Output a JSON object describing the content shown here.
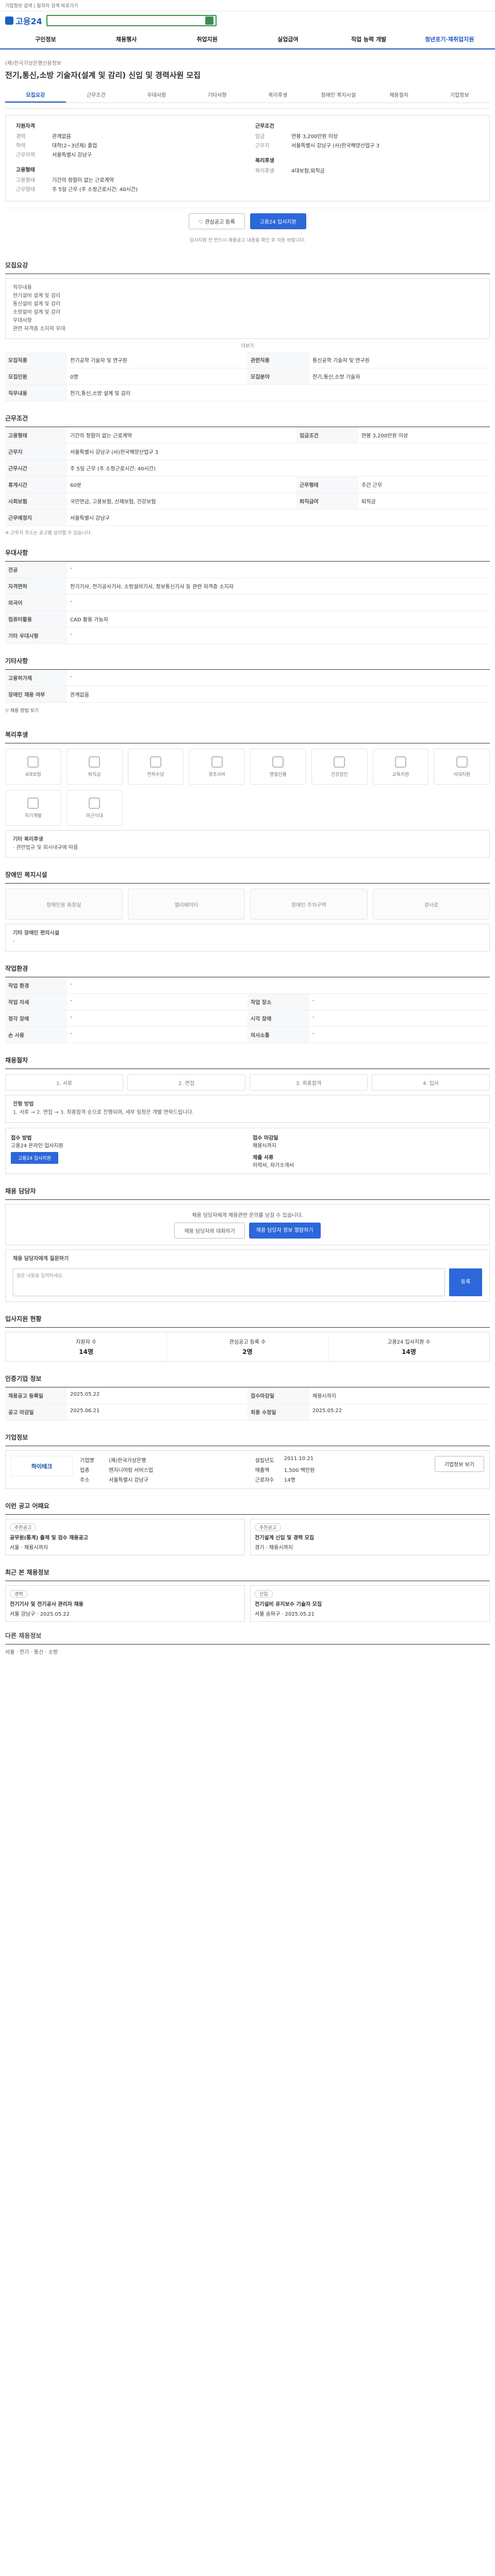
{
  "topbar": {
    "text": "기업정보 검색 | 일자리 검색 바로가기"
  },
  "header": {
    "logo": "고용24",
    "search_placeholder": ""
  },
  "nav": {
    "items": [
      "구인정보",
      "채용행사",
      "취업지원",
      "실업급여",
      "직업 능력 개발",
      "청년포기·재취업지원"
    ]
  },
  "hero": {
    "sub": "(재)한국가상은행신용정보",
    "title": "전기,통신,소방 기술자(설계 및 감리) 신입 및 경력사원 모집"
  },
  "tabs": [
    {
      "label": "모집요강",
      "on": true
    },
    {
      "label": "근무조건",
      "on": false
    },
    {
      "label": "우대사항",
      "on": false
    },
    {
      "label": "기타사항",
      "on": false
    },
    {
      "label": "복리후생",
      "on": false
    },
    {
      "label": "장애인 복지시설",
      "on": false
    },
    {
      "label": "채용절차",
      "on": false
    },
    {
      "label": "기업정보",
      "on": false
    }
  ],
  "summary": {
    "left_title": "지원자격",
    "left": [
      {
        "k": "경력",
        "v": "관계없음"
      },
      {
        "k": "학력",
        "v": "대학(2~3년제) 졸업"
      },
      {
        "k": "근무지역",
        "v": "서울특별시 강남구"
      }
    ],
    "left_title2": "고용형태",
    "left2": [
      {
        "k": "고용형태",
        "v": "기간의 정함이 없는 근로계약"
      },
      {
        "k": "근무형태",
        "v": "주 5일 근무 (주 소정근로시간: 40시간)"
      }
    ],
    "right_title": "근무조건",
    "right": [
      {
        "k": "임금",
        "v": "연봉 3,200만원 이상"
      },
      {
        "k": "근무지",
        "v": "서울특별시 강남구 (사)한국해양산업구 3"
      }
    ],
    "right_title2": "복리후생",
    "right2": [
      {
        "k": "복리후생",
        "v": "4대보험,퇴직금"
      }
    ]
  },
  "actions": {
    "save": "관심공고 등록",
    "apply": "고용24 입사지원"
  },
  "note": "입사지원 전 반드시 채용공고 내용을 확인 후 지원 바랍니다.",
  "recruit": {
    "title": "모집요강",
    "content_lines": [
      "직무내용",
      "전기설비 설계 및 감리",
      "통신설비 설계 및 감리",
      "소방설비 설계 및 감리",
      "우대사항",
      "관련 자격증 소지자 우대"
    ],
    "more": "더보기"
  },
  "recruit_table": [
    {
      "k": "모집직종",
      "v": "전기공학 기술자 및 연구원",
      "k2": "관련직종",
      "v2": "통신공학 기술자 및 연구원"
    },
    {
      "k": "모집인원",
      "v": "0명",
      "k2": "모집분야",
      "v2": "전기,통신,소방 기술자"
    },
    {
      "k": "직무내용",
      "v": "전기,통신,소방 설계 및 감리",
      "k2": "",
      "v2": ""
    }
  ],
  "conditions": {
    "title": "근무조건",
    "rows": [
      {
        "k": "고용형태",
        "v": "기간의 정함이 없는 근로계약",
        "k2": "임금조건",
        "v2": "연봉 3,200만원 이상"
      },
      {
        "k": "근무지",
        "v": "서울특별시 강남구 (사)한국해양산업구 3",
        "k2": "",
        "v2": ""
      },
      {
        "k": "근무시간",
        "v": "주 5일 근무 (주 소정근로시간: 40시간)",
        "k2": "",
        "v2": ""
      },
      {
        "k": "휴게시간",
        "v": "60분",
        "k2": "근무형태",
        "v2": "주간 근무"
      },
      {
        "k": "사회보험",
        "v": "국민연금, 고용보험, 산재보험, 건강보험",
        "k2": "퇴직급여",
        "v2": "퇴직금"
      },
      {
        "k": "근무예정지",
        "v": "서울특별시 강남구",
        "k2": "",
        "v2": ""
      }
    ],
    "note": "※ 근무지 주소는 공고별 상이할 수 있습니다."
  },
  "prefer": {
    "title": "우대사항",
    "rows": [
      {
        "k": "전공",
        "v": "-"
      },
      {
        "k": "자격면허",
        "v": "전기기사, 전기공사기사, 소방설비기사, 정보통신기사 등 관련 자격증 소지자"
      },
      {
        "k": "외국어",
        "v": "-"
      },
      {
        "k": "컴퓨터활용",
        "v": "CAD 활용 가능자"
      },
      {
        "k": "기타 우대사항",
        "v": "-"
      }
    ]
  },
  "etc": {
    "title": "기타사항",
    "rows": [
      {
        "k": "고용허가제",
        "v": "-"
      },
      {
        "k": "장애인 채용 여부",
        "v": "관계없음"
      }
    ],
    "more": "▽ 채용 방법 보기"
  },
  "welfare": {
    "title": "복리후생",
    "items": [
      "4대보험",
      "퇴직금",
      "연차수당",
      "경조사비",
      "명절선물",
      "건강검진",
      "교육지원",
      "식대지원",
      "자기계발",
      "야근식대"
    ],
    "note_title": "기타 복리후생",
    "note": "· 관련법규 및 회사내규에 따름"
  },
  "facility": {
    "title": "장애인 복지시설",
    "items": [
      "장애인용 화장실",
      "엘리베이터",
      "장애인 주차구역",
      "경사로"
    ],
    "note_title": "기타 장애인 편의시설",
    "note": "-"
  },
  "workplace": {
    "title": "작업환경",
    "rows": [
      {
        "k": "작업 환경",
        "v": "-",
        "k2": "",
        "v2": ""
      },
      {
        "k": "작업 자세",
        "v": "-",
        "k2": "작업 장소",
        "v2": "-"
      },
      {
        "k": "청각 장애",
        "v": "-",
        "k2": "시각 장애",
        "v2": "-"
      },
      {
        "k": "손 사용",
        "v": "-",
        "k2": "의사소통",
        "v2": "-"
      }
    ]
  },
  "process": {
    "title": "채용절차",
    "steps": [
      "서류",
      "면접",
      "최종합격",
      "입사"
    ],
    "label": "전형 방법",
    "desc": "1. 서류 → 2. 면접 → 3. 최종합격 순으로 진행되며, 세부 일정은 개별 연락드립니다.",
    "apply_title": "접수 방법",
    "apply_desc": "고용24 온라인 입사지원",
    "apply_btn": "고용24 입사지원",
    "deadline_title": "접수 마감일",
    "deadline": "채용시까지",
    "docs_title": "제출 서류",
    "docs": "이력서, 자기소개서"
  },
  "inquiry": {
    "title": "채용 담당자",
    "text": "채용 담당자에게 채용관련 문의를 남길 수 있습니다.",
    "btn1": "채용 담당자와 대화하기",
    "btn2": "채용 담당자 정보 열람하기",
    "q_title": "채용 담당자에게 질문하기",
    "q_placeholder": "질문 내용을 입력하세요.",
    "q_btn": "등록"
  },
  "stats": {
    "title": "입사지원 현황",
    "items": [
      {
        "label": "지원자 수",
        "num": "14명"
      },
      {
        "label": "관심공고 등록 수",
        "num": "2명"
      },
      {
        "label": "고용24 입사지원 수",
        "num": "14명"
      }
    ]
  },
  "post": {
    "title": "인증기업 정보",
    "rows": [
      {
        "k": "채용공고 등록일",
        "v": "2025.05.22",
        "k2": "접수마감일",
        "v2": "채용시까지"
      },
      {
        "k": "공고 마감일",
        "v": "2025.06.21",
        "k2": "최종 수정일",
        "v2": "2025.05.22"
      }
    ]
  },
  "company": {
    "title": "기업정보",
    "name": "하이테크",
    "info": [
      {
        "k": "기업명",
        "v": "(재)한국가상은행"
      },
      {
        "k": "설립년도",
        "v": "2011.10.21"
      },
      {
        "k": "업종",
        "v": "엔지니어링 서비스업"
      },
      {
        "k": "매출액",
        "v": "1,500 백만원"
      },
      {
        "k": "주소",
        "v": "서울특별시 강남구"
      },
      {
        "k": "근로자수",
        "v": "14명"
      }
    ],
    "btn": "기업정보 보기"
  },
  "recommend": {
    "title": "이런 공고 어때요",
    "cards": [
      {
        "badge": "추천공고",
        "title": "공무원(통계) 출제 및 검수 채용공고",
        "meta": "서울 · 채용시까지"
      },
      {
        "badge": "추천공고",
        "title": "전기설계 신입 및 경력 모집",
        "meta": "경기 · 채용시까지"
      }
    ]
  },
  "recent": {
    "title": "최근 본 채용정보",
    "cards": [
      {
        "badge": "경력",
        "title": "전기기사 및 전기공사 관리자 채용",
        "meta": "서울 강남구 · 2025.05.22"
      },
      {
        "badge": "신입",
        "title": "전기설비 유지보수 기술자 모집",
        "meta": "서울 송파구 · 2025.05.21"
      }
    ]
  },
  "footer": {
    "title": "다른 채용정보",
    "line": "서울 · 전기 · 통신 · 소방"
  }
}
